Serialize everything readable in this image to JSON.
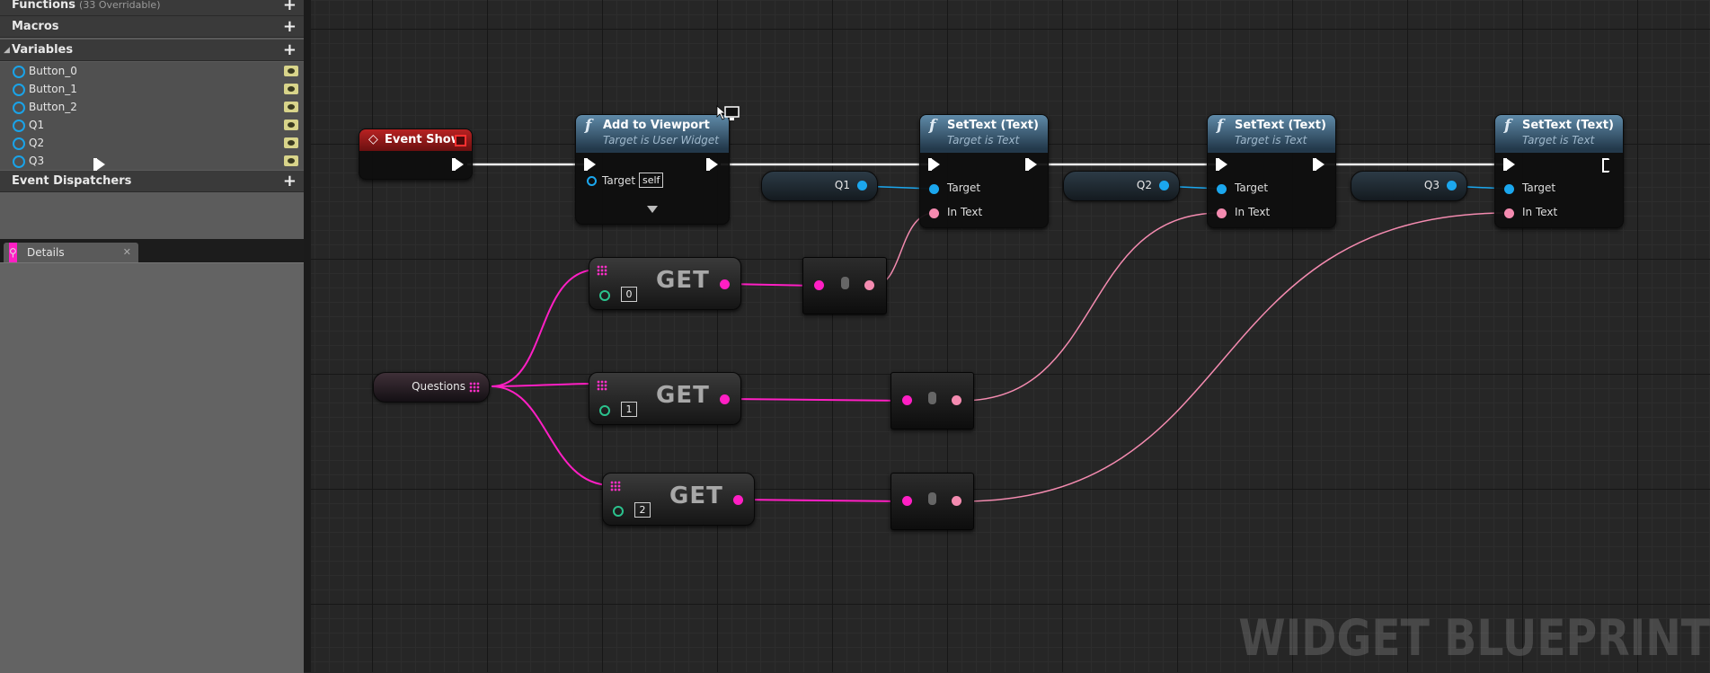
{
  "panel": {
    "functions_label": "Functions",
    "functions_sub": "(33 Overridable)",
    "macros_label": "Macros",
    "variables_label": "Variables",
    "variables": [
      "Button_0",
      "Button_1",
      "Button_2",
      "Q1",
      "Q2",
      "Q3"
    ],
    "event_dispatchers_label": "Event Dispatchers",
    "details_tab": "Details",
    "close_glyph": "✕",
    "plus_glyph": "+"
  },
  "graph": {
    "event_show": "Event Show",
    "add_to_viewport": {
      "title": "Add to Viewport",
      "subtitle": "Target is User Widget",
      "target_label": "Target",
      "target_value": "self"
    },
    "settext_title": "SetText (Text)",
    "settext_subtitle": "Target is Text",
    "target_label": "Target",
    "intext_label": "In Text",
    "var_q1": "Q1",
    "var_q2": "Q2",
    "var_q3": "Q3",
    "questions": "Questions",
    "get_label": "GET",
    "get_index_0": "0",
    "get_index_1": "1",
    "get_index_2": "2",
    "watermark": "WIDGET BLUEPRINT",
    "function_glyph": "f"
  },
  "colors": {
    "object_pin": "#1ba7ee",
    "text_pin": "#f48bb0",
    "array_pin": "#ff1fc4",
    "int_pin": "#2bc28d",
    "event_header": "#b01818",
    "function_header": "#5f8aa8"
  }
}
